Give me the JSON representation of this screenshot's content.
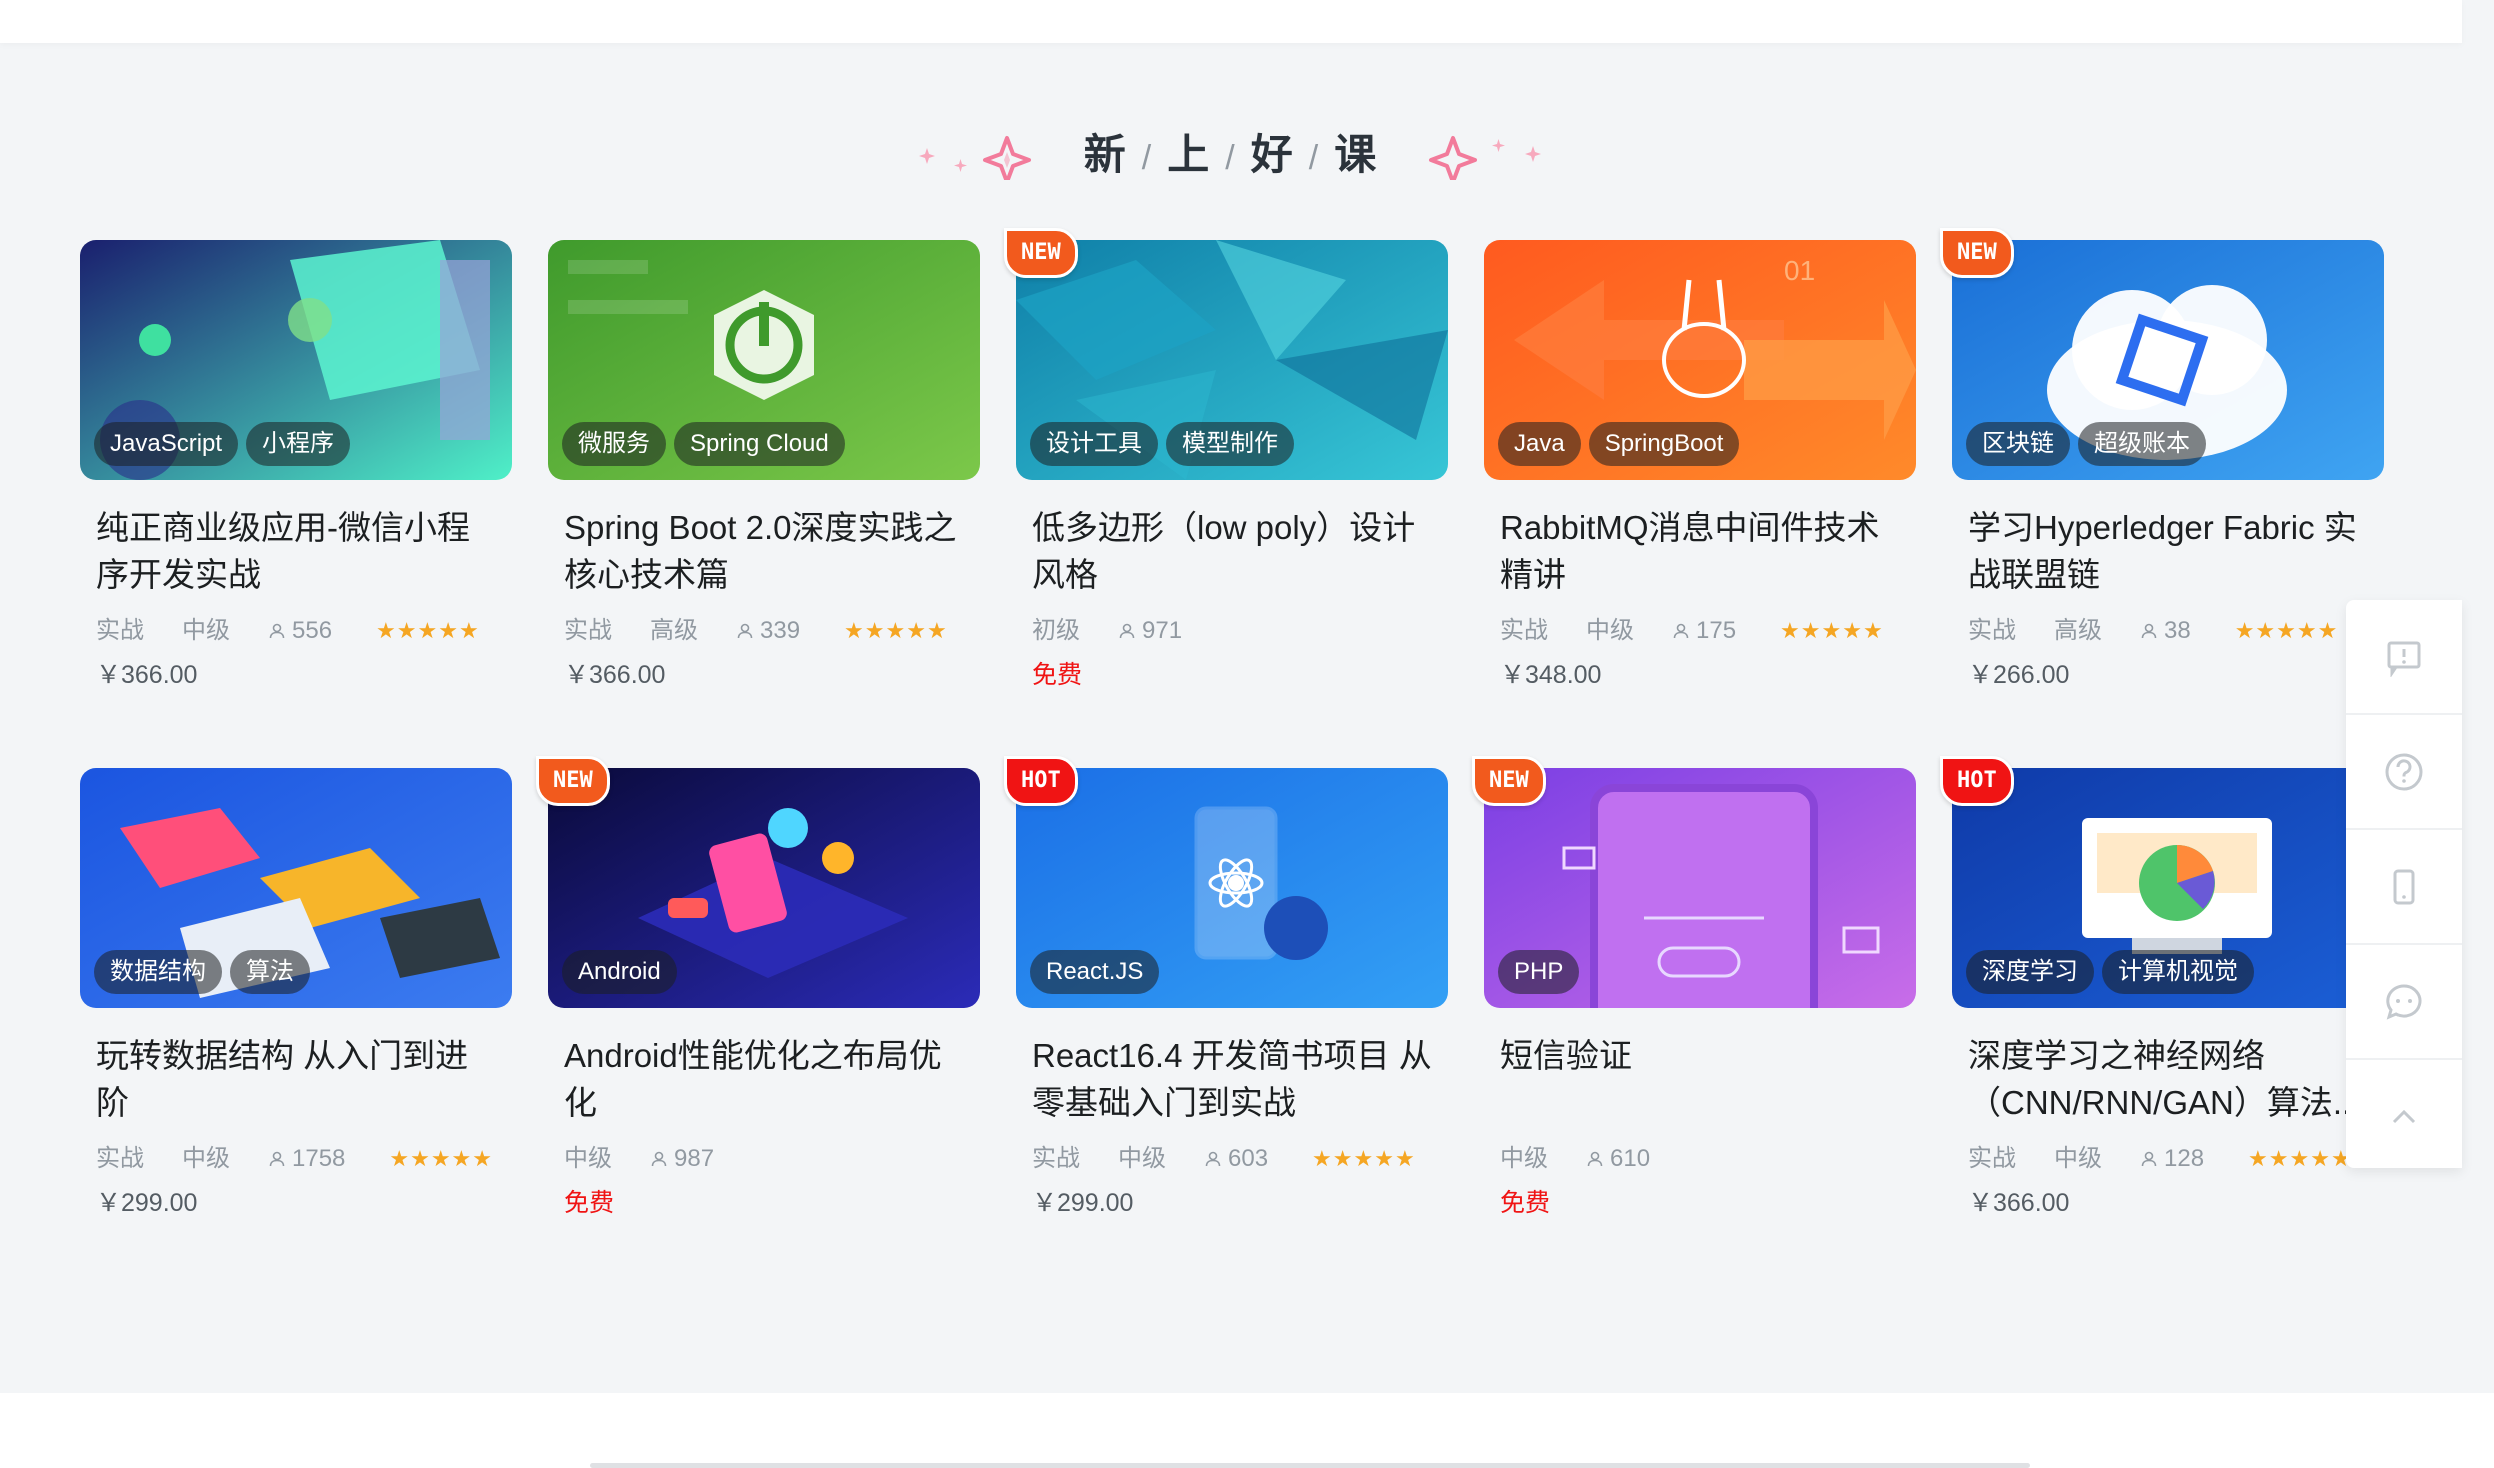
{
  "section": {
    "title_chars": [
      "新",
      "上",
      "好",
      "课"
    ],
    "separator": "/"
  },
  "courses": [
    {
      "title": "纯正商业级应用-微信小程序开发实战",
      "tags": [
        "JavaScript",
        "小程序"
      ],
      "badge": "",
      "type": "实战",
      "level": "中级",
      "students": "556",
      "stars": "★★★★★",
      "price": "￥366.00",
      "thumb_colors": [
        "#1a1f6e",
        "#4ff0c8"
      ]
    },
    {
      "title": "Spring Boot 2.0深度实践之核心技术篇",
      "tags": [
        "微服务",
        "Spring Cloud"
      ],
      "badge": "",
      "type": "实战",
      "level": "高级",
      "students": "339",
      "stars": "★★★★★",
      "price": "￥366.00",
      "thumb_colors": [
        "#3f9a2c",
        "#7cc84a"
      ]
    },
    {
      "title": "低多边形（low poly）设计风格",
      "tags": [
        "设计工具",
        "模型制作"
      ],
      "badge": "NEW",
      "type": "",
      "level": "初级",
      "students": "971",
      "stars": "",
      "price": "免费",
      "thumb_colors": [
        "#0f7fa8",
        "#37c6d6"
      ]
    },
    {
      "title": "RabbitMQ消息中间件技术精讲",
      "tags": [
        "Java",
        "SpringBoot"
      ],
      "badge": "",
      "type": "实战",
      "level": "中级",
      "students": "175",
      "stars": "★★★★★",
      "price": "￥348.00",
      "thumb_colors": [
        "#ff5a1f",
        "#ff8a2a"
      ]
    },
    {
      "title": "学习Hyperledger Fabric 实战联盟链",
      "tags": [
        "区块链",
        "超级账本"
      ],
      "badge": "NEW",
      "type": "实战",
      "level": "高级",
      "students": "38",
      "stars": "★★★★★",
      "price": "￥266.00",
      "thumb_colors": [
        "#1a6fd6",
        "#3fa4f2"
      ]
    },
    {
      "title": "玩转数据结构 从入门到进阶",
      "tags": [
        "数据结构",
        "算法"
      ],
      "badge": "",
      "type": "实战",
      "level": "中级",
      "students": "1758",
      "stars": "★★★★★",
      "price": "￥299.00",
      "thumb_colors": [
        "#1b55e0",
        "#3c7cf0"
      ]
    },
    {
      "title": "Android性能优化之布局优化",
      "tags": [
        "Android"
      ],
      "badge": "NEW",
      "type": "",
      "level": "中级",
      "students": "987",
      "stars": "",
      "price": "免费",
      "thumb_colors": [
        "#0a0a3a",
        "#2b2bb8"
      ]
    },
    {
      "title": "React16.4 开发简书项目 从零基础入门到实战",
      "tags": [
        "React.JS"
      ],
      "badge": "HOT",
      "type": "实战",
      "level": "中级",
      "students": "603",
      "stars": "★★★★★",
      "price": "￥299.00",
      "thumb_colors": [
        "#1b6fe6",
        "#33a0f5"
      ]
    },
    {
      "title": "短信验证",
      "tags": [
        "PHP"
      ],
      "badge": "NEW",
      "type": "",
      "level": "中级",
      "students": "610",
      "stars": "",
      "price": "免费",
      "thumb_colors": [
        "#7b3fe4",
        "#c86de8"
      ]
    },
    {
      "title": "深度学习之神经网络（CNN/RNN/GAN）算法...",
      "tags": [
        "深度学习",
        "计算机视觉"
      ],
      "badge": "HOT",
      "type": "实战",
      "level": "中级",
      "students": "128",
      "stars": "★★★★★",
      "price": "￥366.00",
      "thumb_colors": [
        "#0f3aa8",
        "#1b5fd6"
      ]
    }
  ],
  "sidebar": {
    "items": [
      "feedback-icon",
      "help-icon",
      "mobile-icon",
      "chat-icon",
      "back-to-top-icon"
    ]
  },
  "colors": {
    "accent_red": "#f01414",
    "badge_new": "#f25a1d",
    "star": "#f5a623",
    "deco_pink": "#f27b9b"
  }
}
